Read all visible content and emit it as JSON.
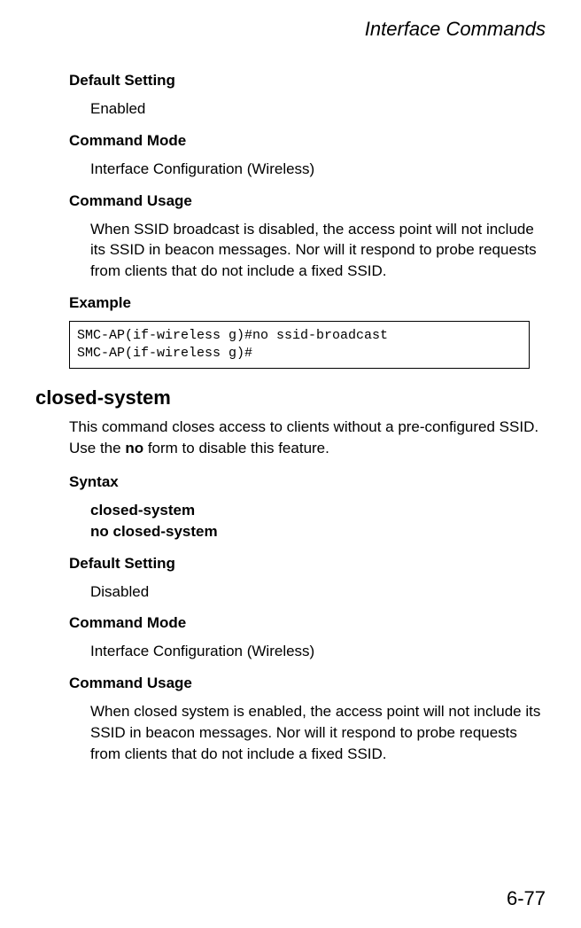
{
  "header": "Interface Commands",
  "section1": {
    "defaultSettingLabel": "Default Setting",
    "defaultSettingValue": "Enabled",
    "commandModeLabel": "Command Mode",
    "commandModeValue": "Interface Configuration (Wireless)",
    "commandUsageLabel": "Command Usage",
    "commandUsageText": "When SSID broadcast is disabled, the access point will not include its SSID in beacon messages. Nor will it respond to probe requests from clients that do not include a fixed SSID.",
    "exampleLabel": "Example",
    "exampleCode": "SMC-AP(if-wireless g)#no ssid-broadcast\nSMC-AP(if-wireless g)#"
  },
  "section2": {
    "commandName": "closed-system",
    "descriptionPrefix": "This command closes access to clients without a pre-configured SSID. Use the ",
    "descriptionBold": "no",
    "descriptionSuffix": " form to disable this feature.",
    "syntaxLabel": "Syntax",
    "syntaxLine1": "closed-system",
    "syntaxLine2": "no closed-system",
    "defaultSettingLabel": "Default Setting",
    "defaultSettingValue": "Disabled",
    "commandModeLabel": "Command Mode",
    "commandModeValue": "Interface Configuration (Wireless)",
    "commandUsageLabel": "Command Usage",
    "commandUsageText": "When closed system is enabled, the access point will not include its SSID in beacon messages. Nor will it respond to probe requests from clients that do not include a fixed SSID."
  },
  "pageNumber": "6-77"
}
